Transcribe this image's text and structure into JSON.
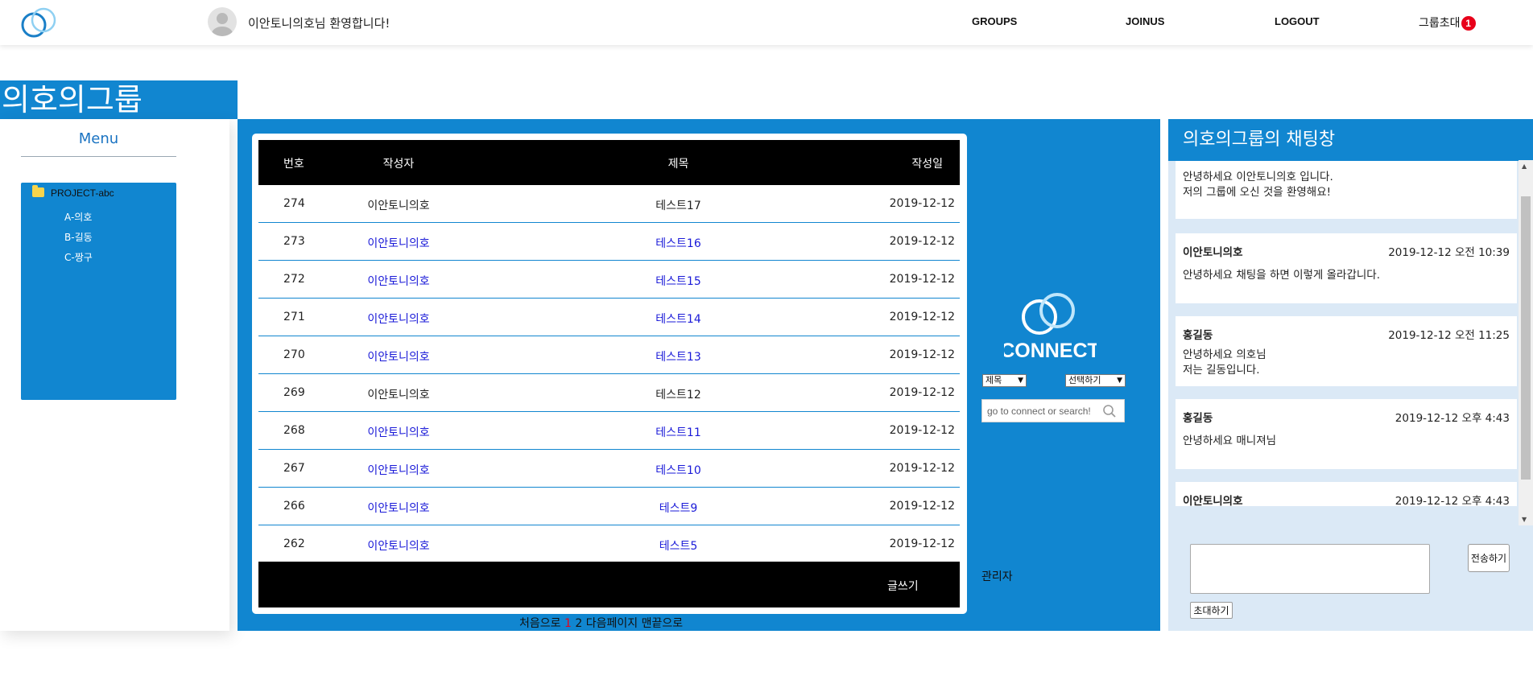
{
  "header": {
    "welcome": "이안토니의호님 환영합니다!",
    "nav": {
      "groups": "GROUPS",
      "joinus": "JOINUS",
      "logout": "LOGOUT",
      "invite": "그룹초대",
      "invite_count": "1"
    }
  },
  "group": {
    "title": "의호의그룹"
  },
  "menu": {
    "title": "Menu",
    "root": "PROJECT-abc",
    "children": [
      "A-의호",
      "B-길동",
      "C-짱구"
    ]
  },
  "board": {
    "columns": {
      "num": "번호",
      "author": "작성자",
      "title": "제목",
      "date": "작성일"
    },
    "rows": [
      {
        "num": "274",
        "author": "이안토니의호",
        "title": "테스트17",
        "date": "2019-12-12"
      },
      {
        "num": "273",
        "author": "이안토니의호",
        "title": "테스트16",
        "date": "2019-12-12"
      },
      {
        "num": "272",
        "author": "이안토니의호",
        "title": "테스트15",
        "date": "2019-12-12"
      },
      {
        "num": "271",
        "author": "이안토니의호",
        "title": "테스트14",
        "date": "2019-12-12"
      },
      {
        "num": "270",
        "author": "이안토니의호",
        "title": "테스트13",
        "date": "2019-12-12"
      },
      {
        "num": "269",
        "author": "이안토니의호",
        "title": "테스트12",
        "date": "2019-12-12"
      },
      {
        "num": "268",
        "author": "이안토니의호",
        "title": "테스트11",
        "date": "2019-12-12"
      },
      {
        "num": "267",
        "author": "이안토니의호",
        "title": "테스트10",
        "date": "2019-12-12"
      },
      {
        "num": "266",
        "author": "이안토니의호",
        "title": "테스트9",
        "date": "2019-12-12"
      },
      {
        "num": "262",
        "author": "이안토니의호",
        "title": "테스트5",
        "date": "2019-12-12"
      }
    ],
    "write_label": "글쓰기",
    "pagination": {
      "first": "처음으로",
      "pages": [
        "1",
        "2"
      ],
      "next": "다음페이지",
      "last": "맨끝으로"
    }
  },
  "search": {
    "field_value": "제목",
    "choose_value": "선택하기",
    "placeholder": "go to connect or search!",
    "logo_text": "CONNECT",
    "admin_label": "관리자"
  },
  "chat": {
    "title": "의호의그룹의 채팅창",
    "welcome_text": "안녕하세요 이안토니의호 입니다.\n저의 그룹에 오신 것을 환영해요!",
    "messages": [
      {
        "who": "이안토니의호",
        "when": "2019-12-12 오전 10:39",
        "text": "안녕하세요 채팅을 하면 이렇게 올라갑니다."
      },
      {
        "who": "홍길동",
        "when": "2019-12-12 오전 11:25",
        "text": "안녕하세요 의호님\n저는 길동입니다."
      },
      {
        "who": "홍길동",
        "when": "2019-12-12 오후 4:43",
        "text": "안녕하세요 매니져님"
      },
      {
        "who": "이안토니의호",
        "when": "2019-12-12 오후 4:43",
        "text": ""
      }
    ],
    "send_label": "전송하기",
    "invite_label": "초대하기"
  },
  "colors": {
    "primary": "#1186d0",
    "link": "#1a1ad8",
    "badge": "#e8001a",
    "chat_bg": "#dbe9f6"
  }
}
